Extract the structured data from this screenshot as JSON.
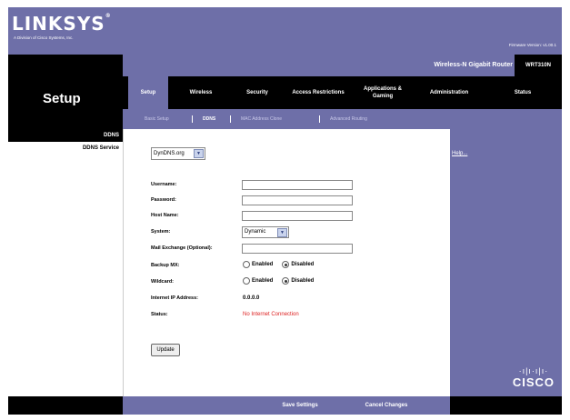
{
  "brand": {
    "logo": "LINKSYS",
    "logo_mark": "®",
    "subline": "A Division of Cisco Systems, Inc.",
    "firmware": "Firmware Version: v1.00.1"
  },
  "product": {
    "name": "Wireless-N Gigabit Router",
    "model": "WRT310N"
  },
  "page_title": "Setup",
  "tabs": [
    {
      "label": "Setup",
      "active": true
    },
    {
      "label": "Wireless",
      "active": false
    },
    {
      "label": "Security",
      "active": false
    },
    {
      "label": "Access Restrictions",
      "active": false
    },
    {
      "label": "Applications & Gaming",
      "active": false
    },
    {
      "label": "Administration",
      "active": false
    },
    {
      "label": "Status",
      "active": false
    }
  ],
  "subtabs": [
    {
      "label": "Basic Setup",
      "active": false
    },
    {
      "label": "DDNS",
      "active": true
    },
    {
      "label": "MAC Address Clone",
      "active": false
    },
    {
      "label": "Advanced Routing",
      "active": false
    }
  ],
  "section": {
    "title": "DDNS",
    "subtitle": "DDNS Service"
  },
  "form": {
    "service_value": "DynDNS.org",
    "fields": {
      "username_label": "Username:",
      "password_label": "Password:",
      "hostname_label": "Host Name:",
      "system_label": "System:",
      "system_value": "Dynamic",
      "mx_label": "Mail Exchange (Optional):",
      "backup_mx_label": "Backup MX:",
      "wildcard_label": "Wildcard:",
      "enabled_label": "Enabled",
      "disabled_label": "Disabled",
      "internet_ip_label": "Internet IP Address:",
      "internet_ip_value": "0.0.0.0",
      "status_label": "Status:",
      "status_value": "No Internet Connection"
    },
    "update_label": "Update"
  },
  "help": {
    "label": "Help..."
  },
  "footer": {
    "save_label": "Save Settings",
    "cancel_label": "Cancel Changes"
  },
  "cisco": {
    "bars": "·ı|ı·ı|ı·",
    "word": "CISCO"
  },
  "colors": {
    "accent": "#6e6fa8",
    "dark": "#000000",
    "status": "#dd2222"
  }
}
